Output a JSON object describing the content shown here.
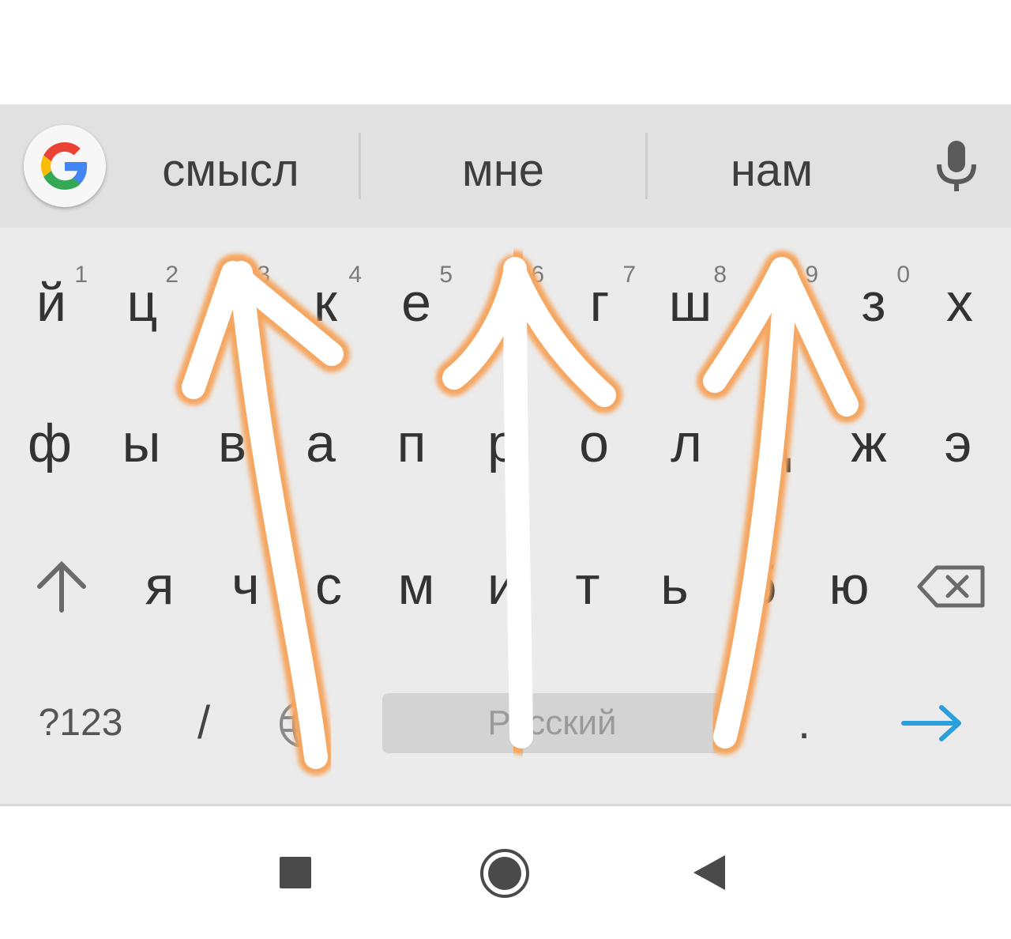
{
  "suggestions": [
    "смысл",
    "мне",
    "нам"
  ],
  "google_button": {
    "icon": "google-g-icon"
  },
  "mic": {
    "icon": "microphone-icon"
  },
  "rows": {
    "row1": [
      {
        "label": "й",
        "hint": "1"
      },
      {
        "label": "ц",
        "hint": "2"
      },
      {
        "label": "у",
        "hint": "3"
      },
      {
        "label": "к",
        "hint": "4"
      },
      {
        "label": "е",
        "hint": "5"
      },
      {
        "label": "н",
        "hint": "6"
      },
      {
        "label": "г",
        "hint": "7"
      },
      {
        "label": "ш",
        "hint": "8"
      },
      {
        "label": "щ",
        "hint": "9"
      },
      {
        "label": "з",
        "hint": "0"
      },
      {
        "label": "х",
        "hint": ""
      }
    ],
    "row2": [
      "ф",
      "ы",
      "в",
      "а",
      "п",
      "р",
      "о",
      "л",
      "д",
      "ж",
      "э"
    ],
    "row3": [
      "я",
      "ч",
      "с",
      "м",
      "и",
      "т",
      "ь",
      "б",
      "ю"
    ]
  },
  "bottom_row": {
    "symbols_label": "?123",
    "slash_label": "/",
    "globe_icon": "globe-icon",
    "space_label": "Русский",
    "period_label": ".",
    "enter_icon": "arrow-right-icon"
  },
  "shift_icon": "shift-arrow-up-icon",
  "backspace_icon": "backspace-icon",
  "navigation": {
    "recents_icon": "square-recents-icon",
    "home_icon": "circle-home-icon",
    "back_icon": "triangle-back-icon"
  },
  "overlay": {
    "description_icon": "swipe-up-arrows-overlay",
    "colors": {
      "stroke": "#ffffff",
      "glow": "#f5a660"
    }
  },
  "colors": {
    "suggestion_bar": "#e1e1e1",
    "keyboard_bg": "#ebebeb",
    "key_text": "#333333",
    "hint_text": "#7a7a7a",
    "enter_arrow": "#2a9fdb"
  }
}
